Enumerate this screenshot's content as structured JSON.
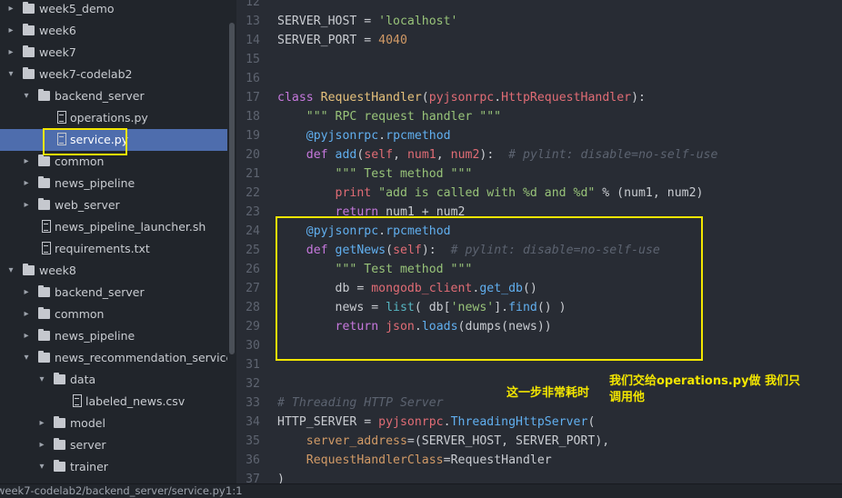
{
  "sidebar": {
    "items": [
      {
        "label": "week5_demo",
        "type": "folder",
        "depth": 0,
        "expanded": false
      },
      {
        "label": "week6",
        "type": "folder",
        "depth": 0,
        "expanded": false
      },
      {
        "label": "week7",
        "type": "folder",
        "depth": 0,
        "expanded": false
      },
      {
        "label": "week7-codelab2",
        "type": "folder",
        "depth": 0,
        "expanded": true
      },
      {
        "label": "backend_server",
        "type": "folder",
        "depth": 1,
        "expanded": true
      },
      {
        "label": "operations.py",
        "type": "file",
        "depth": 2
      },
      {
        "label": "service.py",
        "type": "file",
        "depth": 2,
        "selected": true
      },
      {
        "label": "common",
        "type": "folder",
        "depth": 1,
        "expanded": false
      },
      {
        "label": "news_pipeline",
        "type": "folder",
        "depth": 1,
        "expanded": false
      },
      {
        "label": "web_server",
        "type": "folder",
        "depth": 1,
        "expanded": false
      },
      {
        "label": "news_pipeline_launcher.sh",
        "type": "file",
        "depth": 1
      },
      {
        "label": "requirements.txt",
        "type": "file",
        "depth": 1
      },
      {
        "label": "week8",
        "type": "folder",
        "depth": 0,
        "expanded": true
      },
      {
        "label": "backend_server",
        "type": "folder",
        "depth": 1,
        "expanded": false
      },
      {
        "label": "common",
        "type": "folder",
        "depth": 1,
        "expanded": false
      },
      {
        "label": "news_pipeline",
        "type": "folder",
        "depth": 1,
        "expanded": false
      },
      {
        "label": "news_recommendation_service",
        "type": "folder",
        "depth": 1,
        "expanded": true
      },
      {
        "label": "data",
        "type": "folder",
        "depth": 2,
        "expanded": true
      },
      {
        "label": "labeled_news.csv",
        "type": "file",
        "depth": 3
      },
      {
        "label": "model",
        "type": "folder",
        "depth": 2,
        "expanded": false
      },
      {
        "label": "server",
        "type": "folder",
        "depth": 2,
        "expanded": false
      },
      {
        "label": "trainer",
        "type": "folder",
        "depth": 2,
        "expanded": true
      }
    ]
  },
  "editor": {
    "lines": [
      {
        "n": "12",
        "t": []
      },
      {
        "n": "13",
        "t": [
          [
            "",
            "SERVER_HOST = "
          ],
          [
            "str",
            "'localhost'"
          ]
        ]
      },
      {
        "n": "14",
        "t": [
          [
            "",
            "SERVER_PORT = "
          ],
          [
            "num",
            "4040"
          ]
        ]
      },
      {
        "n": "15",
        "t": []
      },
      {
        "n": "16",
        "t": []
      },
      {
        "n": "17",
        "t": [
          [
            "kw",
            "class "
          ],
          [
            "cls",
            "RequestHandler"
          ],
          [
            "",
            "("
          ],
          [
            "par",
            "pyjsonrpc"
          ],
          [
            "",
            "."
          ],
          [
            "par",
            "HttpRequestHandler"
          ],
          [
            "",
            "):"
          ]
        ]
      },
      {
        "n": "18",
        "t": [
          [
            "str",
            "    \"\"\" RPC request handler \"\"\""
          ]
        ]
      },
      {
        "n": "19",
        "t": [
          [
            "",
            "    "
          ],
          [
            "dec",
            "@pyjsonrpc"
          ],
          [
            "",
            "."
          ],
          [
            "dec",
            "rpcmethod"
          ]
        ]
      },
      {
        "n": "20",
        "t": [
          [
            "kw",
            "    def "
          ],
          [
            "dec",
            "add"
          ],
          [
            "",
            "("
          ],
          [
            "par",
            "self"
          ],
          [
            "",
            ", "
          ],
          [
            "par",
            "num1"
          ],
          [
            "",
            ", "
          ],
          [
            "par",
            "num2"
          ],
          [
            "",
            "):  "
          ],
          [
            "cm",
            "# pylint: disable=no-self-use"
          ]
        ]
      },
      {
        "n": "21",
        "t": [
          [
            "str",
            "        \"\"\" Test method \"\"\""
          ]
        ]
      },
      {
        "n": "22",
        "t": [
          [
            "",
            "        "
          ],
          [
            "mod",
            "print "
          ],
          [
            "str",
            "\"add is called with %d and %d\""
          ],
          [
            "",
            " % (num1, num2)"
          ]
        ]
      },
      {
        "n": "23",
        "t": [
          [
            "",
            "        "
          ],
          [
            "ctl",
            "return"
          ],
          [
            "",
            " num1 + num2"
          ]
        ]
      },
      {
        "n": "24",
        "t": [
          [
            "",
            "    "
          ],
          [
            "dec",
            "@pyjsonrpc"
          ],
          [
            "",
            "."
          ],
          [
            "dec",
            "rpcmethod"
          ]
        ]
      },
      {
        "n": "25",
        "t": [
          [
            "kw",
            "    def "
          ],
          [
            "dec",
            "getNews"
          ],
          [
            "",
            "("
          ],
          [
            "par",
            "self"
          ],
          [
            "",
            "):  "
          ],
          [
            "cm",
            "# pylint: disable=no-self-use"
          ]
        ]
      },
      {
        "n": "26",
        "t": [
          [
            "str",
            "        \"\"\" Test method \"\"\""
          ]
        ]
      },
      {
        "n": "27",
        "t": [
          [
            "",
            "        db = "
          ],
          [
            "mod",
            "mongodb_client"
          ],
          [
            "",
            "."
          ],
          [
            "attr",
            "get_db"
          ],
          [
            "",
            "()"
          ]
        ]
      },
      {
        "n": "28",
        "t": [
          [
            "",
            "        news = "
          ],
          [
            "bi",
            "list"
          ],
          [
            "",
            "( db["
          ],
          [
            "str",
            "'news'"
          ],
          [
            "",
            "]."
          ],
          [
            "attr",
            "find"
          ],
          [
            "",
            "() )"
          ]
        ]
      },
      {
        "n": "29",
        "t": [
          [
            "",
            "        "
          ],
          [
            "ctl",
            "return "
          ],
          [
            "mod",
            "json"
          ],
          [
            "",
            "."
          ],
          [
            "attr",
            "loads"
          ],
          [
            "",
            "(dumps(news))"
          ]
        ]
      },
      {
        "n": "30",
        "t": []
      },
      {
        "n": "31",
        "t": []
      },
      {
        "n": "32",
        "t": []
      },
      {
        "n": "33",
        "t": [
          [
            "cm",
            "# Threading HTTP Server"
          ]
        ]
      },
      {
        "n": "34",
        "t": [
          [
            "",
            "HTTP_SERVER = "
          ],
          [
            "mod",
            "pyjsonrpc"
          ],
          [
            "",
            "."
          ],
          [
            "attr",
            "ThreadingHttpServer"
          ],
          [
            "",
            "("
          ]
        ]
      },
      {
        "n": "35",
        "t": [
          [
            "",
            "    "
          ],
          [
            "num",
            "server_address"
          ],
          [
            "",
            "=(SERVER_HOST, SERVER_PORT),"
          ]
        ]
      },
      {
        "n": "36",
        "t": [
          [
            "",
            "    "
          ],
          [
            "num",
            "RequestHandlerClass"
          ],
          [
            "",
            "=RequestHandler"
          ]
        ]
      },
      {
        "n": "37",
        "t": [
          [
            "",
            ")"
          ]
        ]
      }
    ]
  },
  "annotations": {
    "note1": "这一步非常耗时",
    "note2_line1": "我们交给operations.py做 我们只",
    "note2_line2": "调用他"
  },
  "status": {
    "path": "week7-codelab2/backend_server/service.py",
    "cursor": "1:1"
  }
}
